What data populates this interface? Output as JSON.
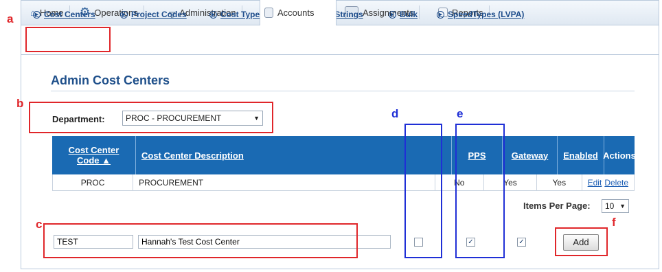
{
  "tabs": [
    {
      "label": "Home",
      "icon": "home-icon"
    },
    {
      "label": "Operations",
      "icon": "gears-icon"
    },
    {
      "label": "Administration",
      "icon": "admin-icon"
    },
    {
      "label": "Accounts",
      "icon": "accounts-icon",
      "active": true
    },
    {
      "label": "Assignments",
      "icon": "assignments-icon"
    },
    {
      "label": "Reports",
      "icon": "reports-icon"
    }
  ],
  "subnav": [
    "Cost Centers",
    "Project Codes",
    "Cost Types",
    "Account Strings",
    "Bulk",
    "SpeedTypes (LVPA)"
  ],
  "page_title": "Admin Cost Centers",
  "department": {
    "label": "Department:",
    "value": "PROC - PROCUREMENT"
  },
  "table": {
    "headers": [
      "Cost Center Code ▲",
      "Cost Center Description",
      "PPS",
      "Gateway",
      "Enabled",
      "Actions"
    ],
    "header_code_line1": "Cost Center",
    "header_code_line2": "Code ▲",
    "rows": [
      {
        "code": "PROC",
        "description": "PROCUREMENT",
        "pps": "No",
        "gateway": "Yes",
        "enabled": "Yes",
        "edit": "Edit",
        "delete": "Delete"
      }
    ]
  },
  "pagination": {
    "label": "Items Per Page:",
    "value": "10"
  },
  "new_row": {
    "code": "TEST",
    "description": "Hannah's Test Cost Center",
    "pps_checked": false,
    "gateway_checked": true,
    "enabled_checked": true,
    "add_label": "Add"
  },
  "annotations": {
    "a": "a",
    "b": "b",
    "c": "c",
    "d": "d",
    "e": "e",
    "f": "f"
  },
  "colors": {
    "header_blue": "#1a6ab3",
    "title_blue": "#1e4f8a",
    "annotation_red": "#e0262a",
    "annotation_blue": "#1f2fd6"
  }
}
